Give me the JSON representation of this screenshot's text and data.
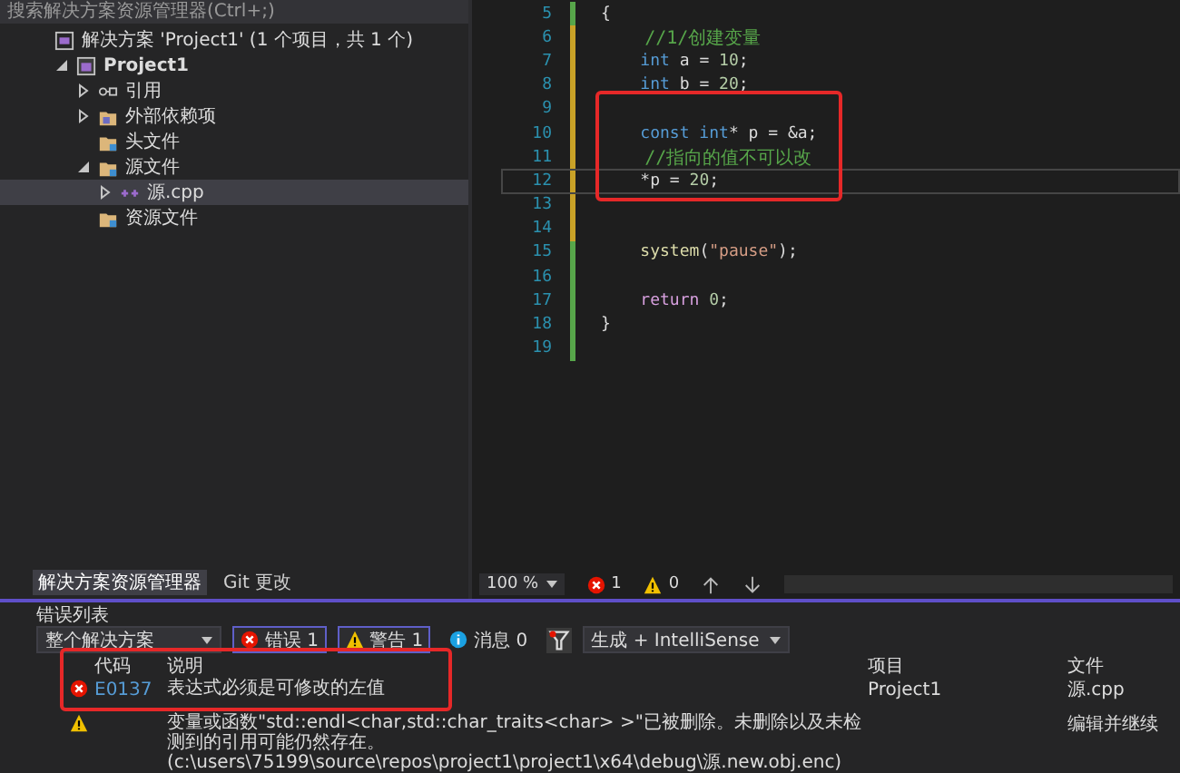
{
  "solution_explorer": {
    "search": {
      "placeholder": "搜索解决方案资源管理器(Ctrl+;)"
    },
    "tree": [
      {
        "label": "解决方案 'Project1' (1 个项目，共 1 个)",
        "kind": "solution",
        "selected": false,
        "children": [
          {
            "label": "Project1",
            "kind": "project",
            "expanded": true,
            "selected": false,
            "children": [
              {
                "label": "引用",
                "kind": "references",
                "expanded": false,
                "selected": false
              },
              {
                "label": "外部依赖项",
                "kind": "external",
                "expanded": false,
                "selected": false
              },
              {
                "label": "头文件",
                "kind": "folder",
                "selected": false
              },
              {
                "label": "源文件",
                "kind": "folder",
                "expanded": true,
                "selected": false,
                "children": [
                  {
                    "label": "源.cpp",
                    "kind": "cpp",
                    "expanded": false,
                    "selected": true
                  }
                ]
              },
              {
                "label": "资源文件",
                "kind": "folder",
                "selected": false
              }
            ]
          }
        ]
      }
    ],
    "tabs": [
      {
        "label": "解决方案资源管理器",
        "selected": true
      },
      {
        "label": "Git 更改",
        "selected": false
      }
    ]
  },
  "editor": {
    "lines": [
      {
        "number": "5",
        "unsaved": false,
        "current": false,
        "tokens": [
          {
            "text": "{",
            "kind": "plain"
          }
        ]
      },
      {
        "number": "6",
        "unsaved": true,
        "current": false,
        "tokens": [
          {
            "text": "    //1/创建变量",
            "kind": "comment"
          }
        ]
      },
      {
        "number": "7",
        "unsaved": true,
        "current": false,
        "tokens": [
          {
            "text": "    int",
            "kind": "keyword"
          },
          {
            "text": " a = ",
            "kind": "plain"
          },
          {
            "text": "10",
            "kind": "number"
          },
          {
            "text": ";",
            "kind": "plain"
          }
        ]
      },
      {
        "number": "8",
        "unsaved": true,
        "current": false,
        "tokens": [
          {
            "text": "    int",
            "kind": "keyword"
          },
          {
            "text": " b = ",
            "kind": "plain"
          },
          {
            "text": "20",
            "kind": "number"
          },
          {
            "text": ";",
            "kind": "plain"
          }
        ]
      },
      {
        "number": "9",
        "unsaved": true,
        "current": false
      },
      {
        "number": "10",
        "unsaved": true,
        "current": false,
        "tokens": [
          {
            "text": "    const int",
            "kind": "keyword"
          },
          {
            "text": "* p = &a;",
            "kind": "plain"
          }
        ]
      },
      {
        "number": "11",
        "unsaved": true,
        "current": false,
        "tokens": [
          {
            "text": "    //指向的值不可以改",
            "kind": "comment"
          }
        ]
      },
      {
        "number": "12",
        "unsaved": true,
        "current": true,
        "tokens": [
          {
            "text": "    *p = ",
            "kind": "plain"
          },
          {
            "text": "20",
            "kind": "number"
          },
          {
            "text": ";",
            "kind": "plain"
          }
        ]
      },
      {
        "number": "13",
        "unsaved": true,
        "current": false
      },
      {
        "number": "14",
        "unsaved": true,
        "current": false
      },
      {
        "number": "15",
        "unsaved": false,
        "current": false,
        "tokens": [
          {
            "text": "    system",
            "kind": "function"
          },
          {
            "text": "(",
            "kind": "plain"
          },
          {
            "text": "\"pause\"",
            "kind": "string"
          },
          {
            "text": ");",
            "kind": "plain"
          }
        ]
      },
      {
        "number": "16",
        "unsaved": false,
        "current": false
      },
      {
        "number": "17",
        "unsaved": false,
        "current": false,
        "tokens": [
          {
            "text": "    return",
            "kind": "control"
          },
          {
            "text": " 0",
            "kind": "number"
          },
          {
            "text": ";",
            "kind": "plain"
          }
        ]
      },
      {
        "number": "18",
        "unsaved": false,
        "current": false,
        "tokens": [
          {
            "text": "}",
            "kind": "plain"
          }
        ]
      },
      {
        "number": "19",
        "unsaved": false,
        "current": false
      }
    ],
    "status": {
      "zoom": "100 %",
      "errors": "1",
      "warnings": "0"
    }
  },
  "error_list": {
    "title": "错误列表",
    "scope": "整个解决方案",
    "filters": [
      {
        "kind": "error",
        "label": "错误 1",
        "selected": true
      },
      {
        "kind": "warning",
        "label": "警告 1",
        "selected": true
      },
      {
        "kind": "info",
        "label": "消息 0",
        "selected": false
      }
    ],
    "source": "生成 + IntelliSense",
    "columns": [
      "代码",
      "说明",
      "项目",
      "文件"
    ],
    "rows": [
      {
        "kind": "error",
        "code": "E0137",
        "description": "表达式必须是可修改的左值",
        "project": "Project1",
        "file": "源.cpp"
      },
      {
        "kind": "warning",
        "description": "变量或函数\"std::endl<char,std::char_traits<char> >\"已被删除。未删除以及未检测到的引用可能仍然存在。(c:\\users\\75199\\source\\repos\\project1\\project1\\x64\\debug\\源.new.obj.enc)",
        "file": "编辑并继续"
      }
    ]
  }
}
